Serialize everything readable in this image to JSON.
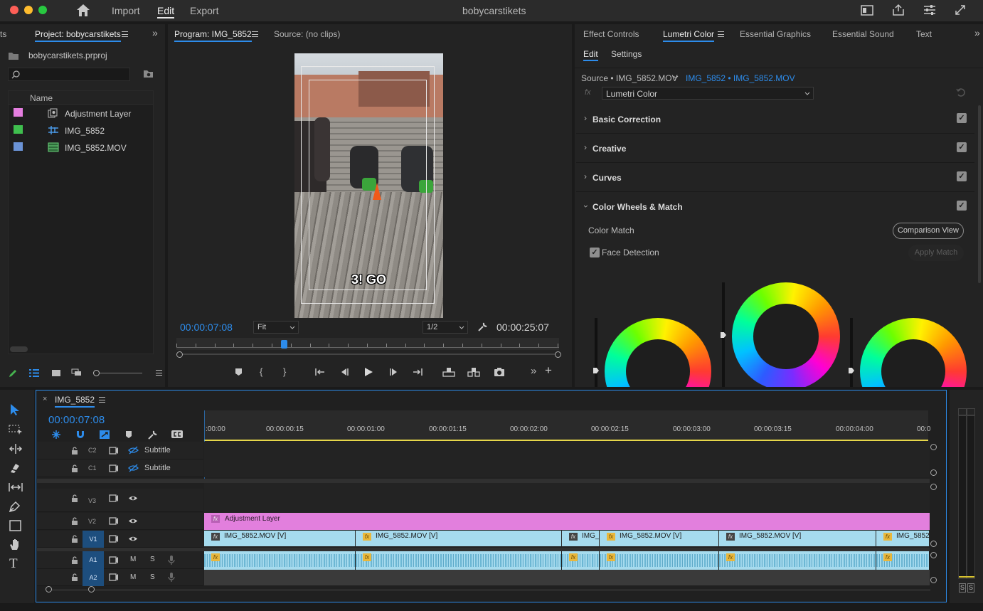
{
  "titlebar": {
    "nav": [
      "Import",
      "Edit",
      "Export"
    ],
    "active": "Edit",
    "project_name": "bobycarstikets"
  },
  "project_panel": {
    "tab_cut": "ts",
    "tab": "Project: bobycarstikets",
    "file": "bobycarstikets.prproj",
    "search_placeholder": "",
    "column": "Name",
    "items": [
      {
        "label": "Adjustment Layer",
        "color": "#e57ee0",
        "icon": "adjustment-layer-icon"
      },
      {
        "label": "IMG_5852",
        "color": "#3fbf4e",
        "icon": "sequence-icon"
      },
      {
        "label": "IMG_5852.MOV",
        "color": "#6b93d6",
        "icon": "video-clip-icon"
      }
    ]
  },
  "program": {
    "tab": "Program: IMG_5852",
    "source_tab": "Source: (no clips)",
    "timecode": "00:00:07:08",
    "fit": "Fit",
    "resolution": "1/2",
    "duration": "00:00:25:07",
    "caption": "3! GO",
    "playhead_fraction": 0.28
  },
  "right_panel": {
    "tabs": [
      "Effect Controls",
      "Lumetri Color",
      "Essential Graphics",
      "Essential Sound",
      "Text"
    ],
    "active_tab": "Lumetri Color",
    "subtabs": [
      "Edit",
      "Settings"
    ],
    "source_label": "Source • IMG_5852.MOV",
    "target_label": "IMG_5852 • IMG_5852.MOV",
    "fx_label": "fx",
    "effect": "Lumetri Color",
    "sections": [
      "Basic Correction",
      "Creative",
      "Curves",
      "Color Wheels & Match"
    ],
    "color_match": "Color Match",
    "comparison_view": "Comparison View",
    "face_detection": "Face Detection",
    "apply_match": "Apply Match"
  },
  "timeline": {
    "sequence": "IMG_5852",
    "close": "×",
    "timecode": "00:00:07:08",
    "ruler": [
      ":00:00",
      "00:00:00:15",
      "00:00:01:00",
      "00:00:01:15",
      "00:00:02:00",
      "00:00:02:15",
      "00:00:03:00",
      "00:00:03:15",
      "00:00:04:00",
      "00:0"
    ],
    "tracks": {
      "c2": {
        "id": "C2",
        "name": "Subtitle"
      },
      "c1": {
        "id": "C1",
        "name": "Subtitle"
      },
      "v3": "V3",
      "v2": "V2",
      "v1": "V1",
      "a1": "A1",
      "a2": "A2",
      "m": "M",
      "s": "S"
    },
    "adjustment_clip": "Adjustment Layer",
    "fx_mark": "fx",
    "video_clips": [
      {
        "label": "IMG_5852.MOV [V]",
        "fx": "grey"
      },
      {
        "label": "IMG_5852.MOV [V]",
        "fx": "yellow"
      },
      {
        "label": "IMG_",
        "fx": "grey"
      },
      {
        "label": "IMG_5852.MOV [V]",
        "fx": "yellow"
      },
      {
        "label": "IMG_5852.MOV [V]",
        "fx": "grey"
      },
      {
        "label": "IMG_5852.",
        "fx": "yellow"
      }
    ]
  },
  "meter": {
    "s_left": "S",
    "s_right": "S"
  },
  "colors": {
    "accent": "#2d8ceb",
    "adjustment": "#e27fdd",
    "video": "#a6dbee",
    "audio": "#a6dbee"
  }
}
